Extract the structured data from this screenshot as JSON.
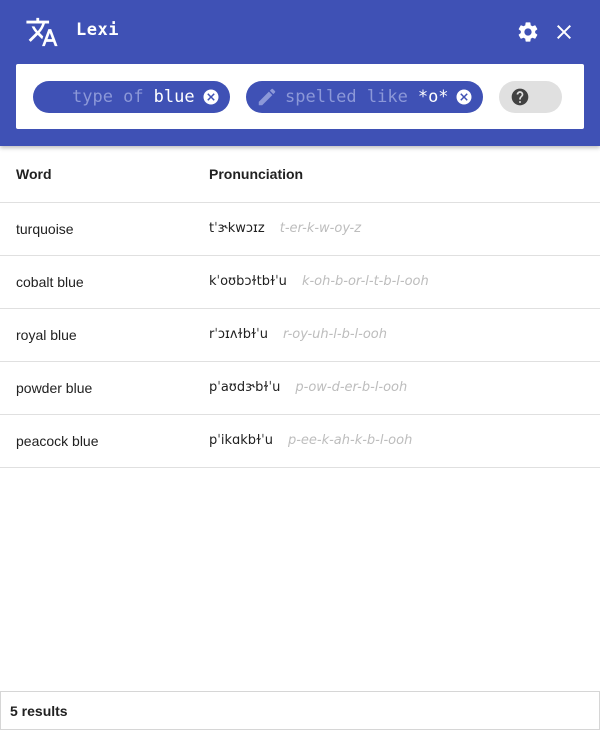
{
  "header": {
    "title": "Lexi",
    "background_color": "#3f51b5",
    "logo_icon": "translate-icon",
    "settings_icon": "gear-icon",
    "close_icon": "close-icon"
  },
  "search": {
    "chips": [
      {
        "label": "type of",
        "value": "blue",
        "clear_icon": "clear-circle-icon"
      },
      {
        "label": "spelled like",
        "value": "*o*",
        "lead_icon": "pencil-icon",
        "clear_icon": "clear-circle-icon"
      }
    ],
    "help_icon": "help-circle-icon"
  },
  "table": {
    "columns": [
      "Word",
      "Pronunciation"
    ],
    "rows": [
      {
        "word": "turquoise",
        "ipa": "tˈɝkwɔɪz",
        "respelling": "t-er-k-w-oy-z"
      },
      {
        "word": "cobalt blue",
        "ipa": "kˈoʊbɔɫtbɫˈu",
        "respelling": "k-oh-b-or-l-t-b-l-ooh"
      },
      {
        "word": "royal blue",
        "ipa": "rˈɔɪʌɫbɫˈu",
        "respelling": "r-oy-uh-l-b-l-ooh"
      },
      {
        "word": "powder blue",
        "ipa": "pˈaʊdɝbɫˈu",
        "respelling": "p-ow-d-er-b-l-ooh"
      },
      {
        "word": "peacock blue",
        "ipa": "pˈikɑkbɫˈu",
        "respelling": "p-ee-k-ah-k-b-l-ooh"
      }
    ]
  },
  "footer": {
    "result_count": "5 results"
  }
}
